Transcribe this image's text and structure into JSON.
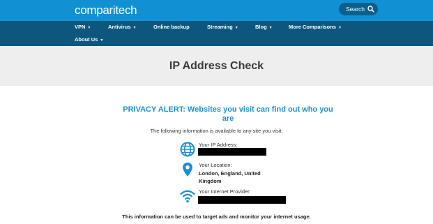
{
  "header": {
    "logo": "comparitech",
    "search_label": "Search"
  },
  "nav": {
    "items": [
      {
        "label": "VPN"
      },
      {
        "label": "Antivirus"
      },
      {
        "label": "Online backup"
      },
      {
        "label": "Streaming"
      },
      {
        "label": "Blog"
      },
      {
        "label": "More Comparisons"
      },
      {
        "label": "About Us"
      }
    ]
  },
  "page": {
    "title": "IP Address Check",
    "alert": "PRIVACY ALERT: Websites you visit can find out who you are",
    "intro": "The following information is available to any site you visit:",
    "ip_label": "Your IP Address:",
    "location_label": "Your Location:",
    "location_value": "London, England, United Kingdom",
    "provider_label": "Your Internet Provider:",
    "footer_note": "This information can be used to target ads and monitor your internet usage."
  },
  "colors": {
    "topbar": "#1190d4",
    "navbar": "#0d577f",
    "accent": "#1a8fd0"
  }
}
